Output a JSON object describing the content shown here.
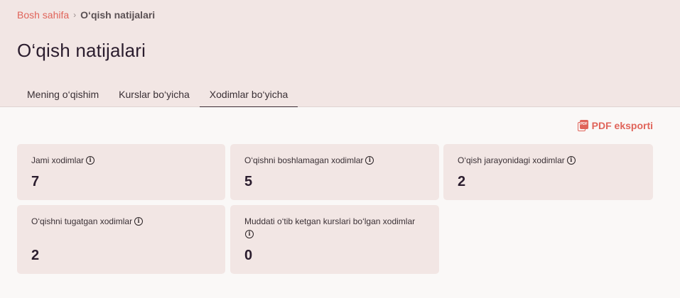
{
  "breadcrumb": {
    "home": "Bosh sahifa",
    "separator": "›",
    "current": "O‘qish natijalari"
  },
  "page": {
    "title": "O‘qish natijalari"
  },
  "tabs": [
    {
      "label": "Mening o‘qishim",
      "active": false
    },
    {
      "label": "Kurslar bo‘yicha",
      "active": false
    },
    {
      "label": "Xodimlar bo‘yicha",
      "active": true
    }
  ],
  "actions": {
    "export_label": "PDF eksporti",
    "export_icon": "pdf-file-icon"
  },
  "stats": [
    {
      "label": "Jami xodimlar",
      "value": "7"
    },
    {
      "label": "O‘qishni boshlamagan xodimlar",
      "value": "5"
    },
    {
      "label": "O‘qish jarayonidagi xodimlar",
      "value": "2"
    },
    {
      "label": "O‘qishni tugatgan xodimlar",
      "value": "2"
    },
    {
      "label": "Muddati o‘tib ketgan kurslari bo‘lgan xodimlar",
      "value": "0"
    }
  ],
  "colors": {
    "accent": "#e0645a",
    "header_bg": "#f2e6e4",
    "card_bg": "#f2e6e4",
    "page_bg": "#faf8f7"
  }
}
